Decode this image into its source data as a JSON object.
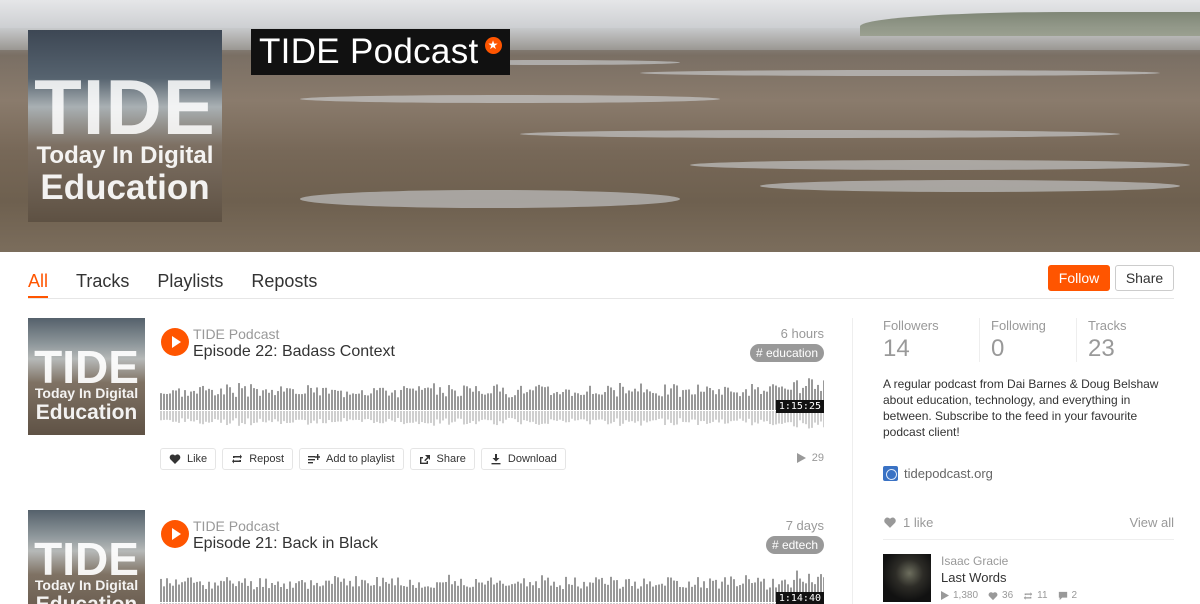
{
  "header": {
    "title": "TIDE Podcast",
    "pro_badge": "★",
    "cover": {
      "line1": "TIDE",
      "line2": "Today In Digital",
      "line3": "Education"
    }
  },
  "tabs": [
    {
      "label": "All",
      "active": true
    },
    {
      "label": "Tracks",
      "active": false
    },
    {
      "label": "Playlists",
      "active": false
    },
    {
      "label": "Reposts",
      "active": false
    }
  ],
  "buttons": {
    "follow": "Follow",
    "share": "Share"
  },
  "tracks": [
    {
      "uploader": "TIDE Podcast",
      "title": "Episode 22: Badass Context",
      "age": "6 hours",
      "tag": "# education",
      "duration": "1:15:25",
      "plays": "29",
      "art": {
        "line1": "TIDE",
        "line2": "Today In Digital",
        "line3": "Education"
      }
    },
    {
      "uploader": "TIDE Podcast",
      "title": "Episode 21: Back in Black",
      "age": "7 days",
      "tag": "# edtech",
      "duration": "1:14:40",
      "art": {
        "line1": "TIDE",
        "line2": "Today In Digital",
        "line3": "Education"
      }
    }
  ],
  "actions": {
    "like": "Like",
    "repost": "Repost",
    "add_to_playlist": "Add to playlist",
    "share": "Share",
    "download": "Download"
  },
  "sidebar": {
    "stats": [
      {
        "label": "Followers",
        "value": "14"
      },
      {
        "label": "Following",
        "value": "0"
      },
      {
        "label": "Tracks",
        "value": "23"
      }
    ],
    "bio": "A regular podcast from Dai Barnes & Doug Belshaw about education, technology, and everything in between. Subscribe to the feed in your favourite podcast client!",
    "website": "tidepodcast.org",
    "likes_header": "1 like",
    "view_all": "View all",
    "liked_track": {
      "user": "Isaac Gracie",
      "title": "Last Words",
      "plays": "1,380",
      "likes": "36",
      "reposts": "11",
      "comments": "2"
    }
  },
  "colors": {
    "accent": "#ff5500",
    "tag_bg": "#999999",
    "text": "#333333",
    "muted": "#999999"
  }
}
